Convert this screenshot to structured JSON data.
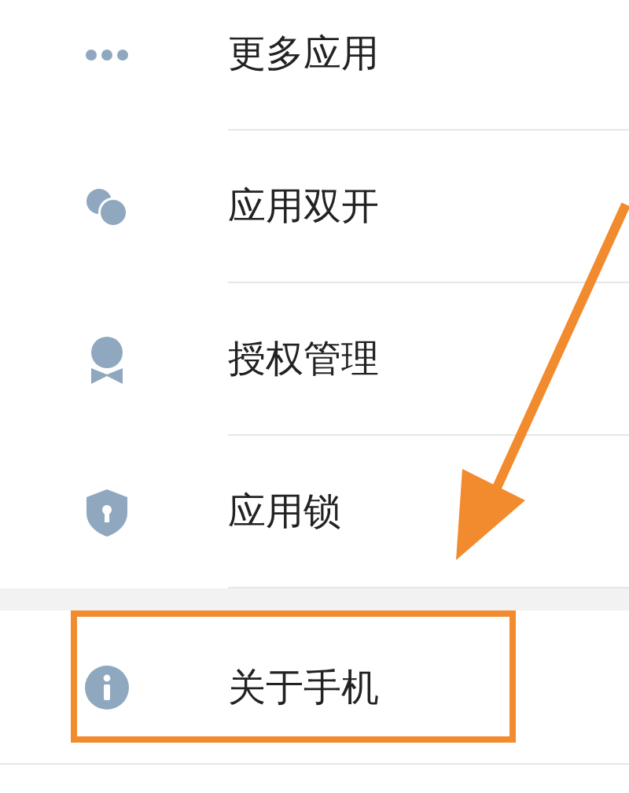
{
  "sections": [
    {
      "items": [
        {
          "kind": "more",
          "label": "更多应用",
          "highlighted": false
        },
        {
          "kind": "dual",
          "label": "应用双开",
          "highlighted": false
        },
        {
          "kind": "badge",
          "label": "授权管理",
          "highlighted": false
        },
        {
          "kind": "lock",
          "label": "应用锁",
          "highlighted": false
        }
      ]
    },
    {
      "items": [
        {
          "kind": "info",
          "label": "关于手机",
          "highlighted": true
        }
      ]
    }
  ]
}
